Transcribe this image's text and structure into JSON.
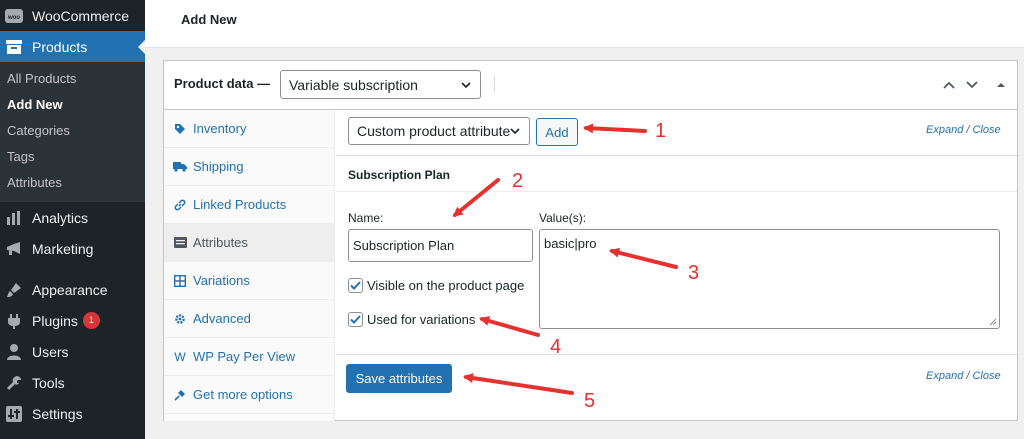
{
  "sidebar": {
    "woocommerce": "WooCommerce",
    "products": "Products",
    "submenu": [
      "All Products",
      "Add New",
      "Categories",
      "Tags",
      "Attributes"
    ],
    "items": [
      {
        "label": "Analytics"
      },
      {
        "label": "Marketing"
      },
      {
        "label": "Appearance"
      },
      {
        "label": "Plugins",
        "badge": "1"
      },
      {
        "label": "Users"
      },
      {
        "label": "Tools"
      },
      {
        "label": "Settings"
      }
    ],
    "woo_logo_text": "woo"
  },
  "header": {
    "title": "Add New"
  },
  "product_data": {
    "label": "Product data —",
    "type_value": "Variable subscription",
    "tabs": [
      {
        "label": "Inventory",
        "icon": "tag-icon"
      },
      {
        "label": "Shipping",
        "icon": "truck-icon"
      },
      {
        "label": "Linked Products",
        "icon": "link-icon"
      },
      {
        "label": "Attributes",
        "icon": "list-icon"
      },
      {
        "label": "Variations",
        "icon": "grid-icon"
      },
      {
        "label": "Advanced",
        "icon": "gear-icon"
      },
      {
        "label": "WP Pay Per View",
        "icon": "w-icon",
        "glyph": "W"
      },
      {
        "label": "Get more options",
        "icon": "plug-icon"
      }
    ],
    "attribute_select": "Custom product attribute",
    "add_label": "Add",
    "expand": "Expand",
    "slash": " / ",
    "close": "Close",
    "attribute": {
      "heading": "Subscription Plan",
      "name_label": "Name:",
      "name_value": "Subscription Plan",
      "values_label": "Value(s):",
      "values_value": "basic|pro",
      "visible_label": "Visible on the product page",
      "variations_label": "Used for variations"
    },
    "save_label": "Save attributes"
  },
  "annotations": [
    "1",
    "2",
    "3",
    "4",
    "5"
  ],
  "colors": {
    "accent": "#2271b1",
    "sidebar": "#1d2327",
    "annotation": "#e8312f"
  }
}
